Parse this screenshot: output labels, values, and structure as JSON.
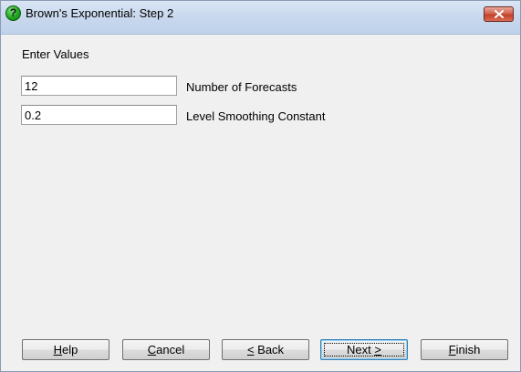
{
  "window": {
    "title": "Brown's Exponential: Step 2",
    "icon": "help-question-icon",
    "close_icon": "close-icon"
  },
  "form": {
    "heading": "Enter Values",
    "fields": [
      {
        "label": "Number of Forecasts",
        "value": "12"
      },
      {
        "label": "Level Smoothing Constant",
        "value": "0.2"
      }
    ]
  },
  "buttons": {
    "help": {
      "mnemonic": "H",
      "rest": "elp"
    },
    "cancel": {
      "mnemonic": "C",
      "rest": "ancel"
    },
    "back": {
      "mnemonic": "<",
      "rest": " Back"
    },
    "next": {
      "pre": "Next ",
      "mnemonic": ">"
    },
    "finish": {
      "mnemonic": "F",
      "rest": "inish"
    }
  },
  "colors": {
    "title_gradient_top": "#dbe6f4",
    "close_button_red": "#c3402a",
    "default_button_border": "#3c7fb1"
  }
}
